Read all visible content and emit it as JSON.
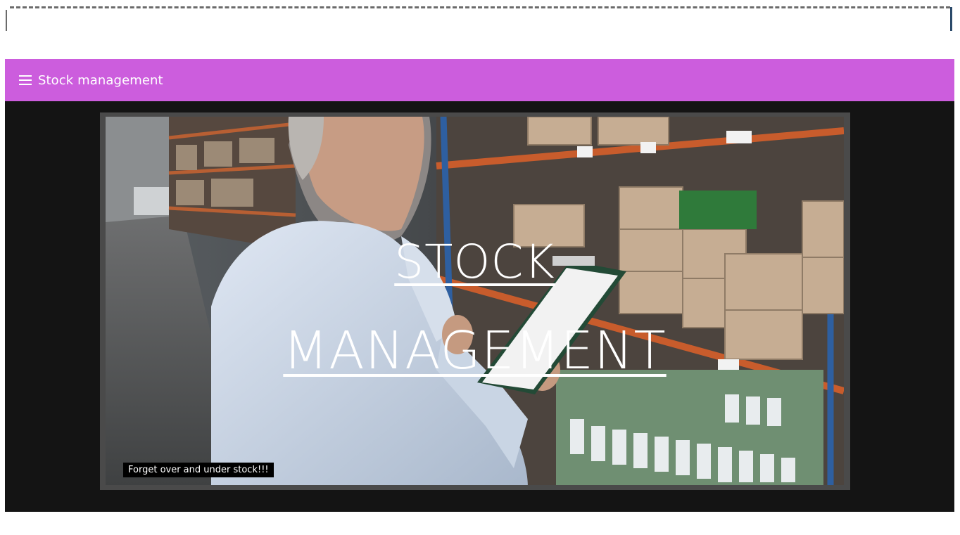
{
  "appbar": {
    "title": "Stock management",
    "menu_icon": "hamburger-menu-icon",
    "color": "#cc5ddd"
  },
  "hero": {
    "title_line1": "STOCK",
    "title_line2": "MANAGEMENT",
    "caption": "Forget over and under stock!!!"
  }
}
